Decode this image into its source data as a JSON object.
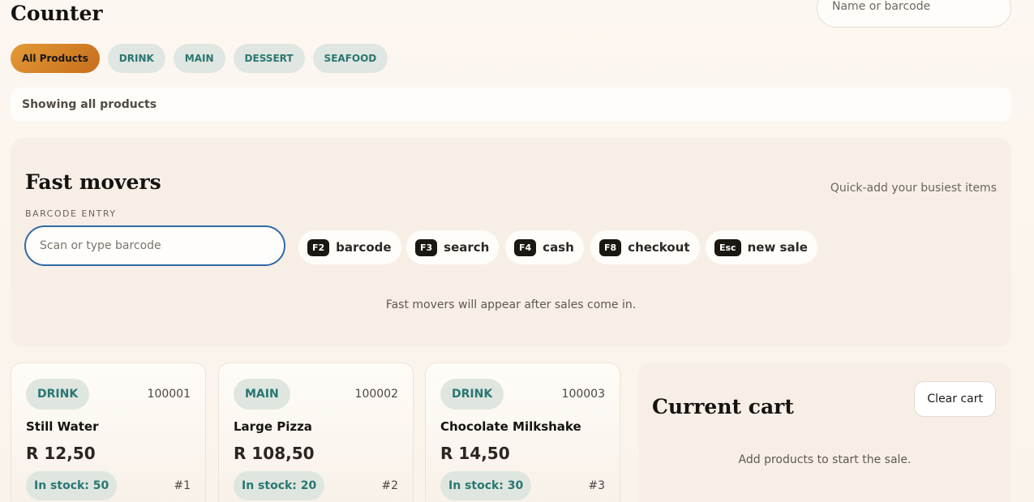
{
  "header": {
    "title": "Counter",
    "search_placeholder": "Name or barcode"
  },
  "categories": [
    {
      "label": "All Products",
      "active": true
    },
    {
      "label": "DRINK",
      "active": false
    },
    {
      "label": "MAIN",
      "active": false
    },
    {
      "label": "DESSERT",
      "active": false
    },
    {
      "label": "SEAFOOD",
      "active": false
    }
  ],
  "status": {
    "text": "Showing all products"
  },
  "fast_movers": {
    "title": "Fast movers",
    "subtitle": "Quick-add your busiest items",
    "barcode_label": "BARCODE ENTRY",
    "barcode_placeholder": "Scan or type barcode",
    "shortcuts": [
      {
        "key": "F2",
        "label": "barcode"
      },
      {
        "key": "F3",
        "label": "search"
      },
      {
        "key": "F4",
        "label": "cash"
      },
      {
        "key": "F8",
        "label": "checkout"
      },
      {
        "key": "Esc",
        "label": "new sale"
      }
    ],
    "empty_text": "Fast movers will appear after sales come in."
  },
  "products": [
    {
      "category": "DRINK",
      "code": "100001",
      "name": "Still Water",
      "price": "R 12,50",
      "stock": "In stock: 50",
      "index": "#1"
    },
    {
      "category": "MAIN",
      "code": "100002",
      "name": "Large Pizza",
      "price": "R 108,50",
      "stock": "In stock: 20",
      "index": "#2"
    },
    {
      "category": "DRINK",
      "code": "100003",
      "name": "Chocolate Milkshake",
      "price": "R 14,50",
      "stock": "In stock: 30",
      "index": "#3"
    }
  ],
  "cart": {
    "title": "Current cart",
    "clear_label": "Clear cart",
    "empty_text": "Add products to start the sale."
  },
  "colors": {
    "accent": "#d9822b",
    "teal": "#2a7672",
    "focus": "#2f6aa8"
  }
}
